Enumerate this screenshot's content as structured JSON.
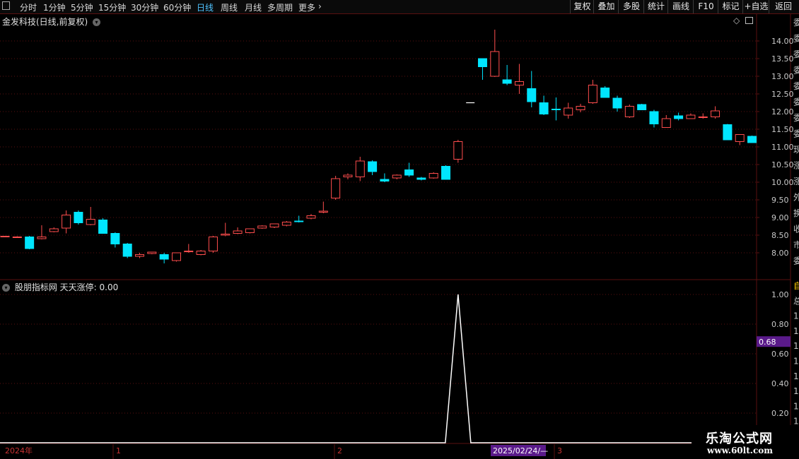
{
  "toolbar": {
    "periods": [
      {
        "label": "分时",
        "active": false
      },
      {
        "label": "1分钟",
        "active": false
      },
      {
        "label": "5分钟",
        "active": false
      },
      {
        "label": "15分钟",
        "active": false
      },
      {
        "label": "30分钟",
        "active": false
      },
      {
        "label": "60分钟",
        "active": false
      },
      {
        "label": "日线",
        "active": true
      },
      {
        "label": "周线",
        "active": false
      },
      {
        "label": "月线",
        "active": false
      },
      {
        "label": "多周期",
        "active": false
      },
      {
        "label": "更多",
        "active": false
      }
    ],
    "right_buttons": [
      "复权",
      "叠加",
      "多股",
      "统计",
      "画线",
      "F10",
      "标记",
      "+自选",
      "返回"
    ]
  },
  "main_chart": {
    "title": "金发科技(日线,前复权)",
    "y_ticks": [
      "14.00",
      "13.50",
      "13.00",
      "12.50",
      "12.00",
      "11.50",
      "11.00",
      "10.50",
      "10.00",
      "9.50",
      "9.00",
      "8.50",
      "8.00"
    ],
    "y_tick_values": [
      14.0,
      13.5,
      13.0,
      12.5,
      12.0,
      11.5,
      11.0,
      10.5,
      10.0,
      9.5,
      9.0,
      8.5,
      8.0
    ],
    "ylim": [
      7.65,
      14.3
    ]
  },
  "indicator": {
    "title": "股朋指标网 天天涨停: 0.00",
    "y_ticks": [
      "1.00",
      "0.80",
      "0.60",
      "0.40",
      "0.20"
    ],
    "y_tick_values": [
      1.0,
      0.8,
      0.6,
      0.4,
      0.2
    ],
    "current_value": "0.68",
    "ylim": [
      0,
      1.0
    ]
  },
  "right_panel_glyphs": [
    "委",
    "委",
    "委",
    "委",
    "委",
    "委",
    "委",
    "委",
    "现",
    "涨",
    "涨",
    "外",
    "换",
    "收",
    "市",
    "委",
    "自",
    "总",
    "1",
    "1",
    "1",
    "1",
    "1",
    "1",
    "1",
    "1",
    "1"
  ],
  "time_axis": {
    "year_label": "2024年",
    "month_labels": [
      "1",
      "2",
      "3"
    ],
    "cursor_label": "2025/02/24/—"
  },
  "watermark": {
    "line1": "乐淘公式网",
    "line2": "www.60lt.com"
  },
  "colors": {
    "up": "#ff4d4d",
    "down": "#00e5ff",
    "grid": "#5a1010",
    "axis_text": "#c8c8c8"
  },
  "chart_data": {
    "type": "candlestick",
    "ohlc": [
      [
        8.45,
        8.48,
        8.44,
        8.47
      ],
      [
        8.45,
        8.47,
        8.43,
        8.45
      ],
      [
        8.45,
        8.48,
        8.1,
        8.12
      ],
      [
        8.4,
        8.78,
        8.38,
        8.45
      ],
      [
        8.6,
        8.72,
        8.58,
        8.68
      ],
      [
        8.7,
        9.2,
        8.55,
        9.07
      ],
      [
        9.15,
        9.2,
        8.8,
        8.85
      ],
      [
        8.8,
        9.3,
        8.78,
        8.95
      ],
      [
        8.93,
        8.98,
        8.55,
        8.55
      ],
      [
        8.55,
        8.58,
        8.15,
        8.25
      ],
      [
        8.25,
        8.28,
        7.85,
        7.9
      ],
      [
        7.9,
        8.0,
        7.85,
        7.95
      ],
      [
        7.98,
        8.03,
        7.96,
        8.02
      ],
      [
        7.95,
        8.0,
        7.7,
        7.82
      ],
      [
        7.78,
        8.0,
        7.75,
        8.0
      ],
      [
        8.05,
        8.25,
        8.0,
        8.05
      ],
      [
        7.95,
        8.08,
        7.93,
        8.05
      ],
      [
        8.05,
        8.48,
        8.0,
        8.45
      ],
      [
        8.5,
        8.85,
        8.47,
        8.53
      ],
      [
        8.55,
        8.72,
        8.53,
        8.62
      ],
      [
        8.57,
        8.68,
        8.55,
        8.68
      ],
      [
        8.7,
        8.78,
        8.68,
        8.76
      ],
      [
        8.73,
        8.82,
        8.7,
        8.82
      ],
      [
        8.78,
        8.9,
        8.75,
        8.87
      ],
      [
        8.9,
        9.05,
        8.86,
        8.88
      ],
      [
        8.98,
        9.1,
        8.95,
        9.05
      ],
      [
        9.15,
        9.45,
        9.12,
        9.18
      ],
      [
        9.55,
        10.18,
        9.5,
        10.1
      ],
      [
        10.15,
        10.25,
        10.08,
        10.2
      ],
      [
        10.15,
        10.72,
        10.03,
        10.6
      ],
      [
        10.58,
        10.62,
        10.2,
        10.3
      ],
      [
        10.08,
        10.25,
        10.0,
        10.03
      ],
      [
        10.12,
        10.22,
        10.08,
        10.2
      ],
      [
        10.35,
        10.55,
        10.15,
        10.2
      ],
      [
        10.12,
        10.15,
        10.05,
        10.08
      ],
      [
        10.12,
        10.28,
        10.1,
        10.25
      ],
      [
        10.45,
        10.48,
        10.15,
        10.08
      ],
      [
        10.65,
        11.2,
        10.55,
        11.15
      ],
      [
        12.25,
        12.25,
        12.25,
        12.25
      ],
      [
        13.5,
        13.48,
        12.9,
        13.27
      ],
      [
        13.0,
        14.32,
        12.98,
        13.7
      ],
      [
        12.9,
        13.32,
        12.75,
        12.8
      ],
      [
        12.75,
        13.35,
        12.5,
        12.85
      ],
      [
        12.65,
        13.15,
        12.12,
        12.28
      ],
      [
        12.25,
        12.45,
        11.9,
        11.93
      ],
      [
        12.07,
        12.4,
        11.75,
        12.05
      ],
      [
        11.9,
        12.25,
        11.8,
        12.1
      ],
      [
        12.05,
        12.22,
        11.98,
        12.15
      ],
      [
        12.25,
        12.9,
        12.22,
        12.75
      ],
      [
        12.67,
        12.72,
        12.4,
        12.4
      ],
      [
        12.38,
        12.45,
        12.0,
        12.1
      ],
      [
        11.85,
        12.2,
        11.82,
        12.15
      ],
      [
        12.2,
        12.22,
        12.05,
        12.05
      ],
      [
        12.0,
        12.05,
        11.55,
        11.65
      ],
      [
        11.55,
        11.9,
        11.55,
        11.8
      ],
      [
        11.88,
        11.97,
        11.75,
        11.8
      ],
      [
        11.8,
        11.95,
        11.8,
        11.9
      ],
      [
        11.85,
        11.95,
        11.8,
        11.85
      ],
      [
        11.85,
        12.15,
        11.8,
        12.02
      ],
      [
        11.63,
        11.65,
        11.2,
        11.2
      ],
      [
        11.15,
        11.35,
        11.05,
        11.35
      ],
      [
        11.3,
        11.32,
        11.12,
        11.12
      ]
    ],
    "indicator_series": {
      "name": "天天涨停",
      "spike_index": 37,
      "baseline": 0,
      "spike_value": 1.0
    }
  }
}
